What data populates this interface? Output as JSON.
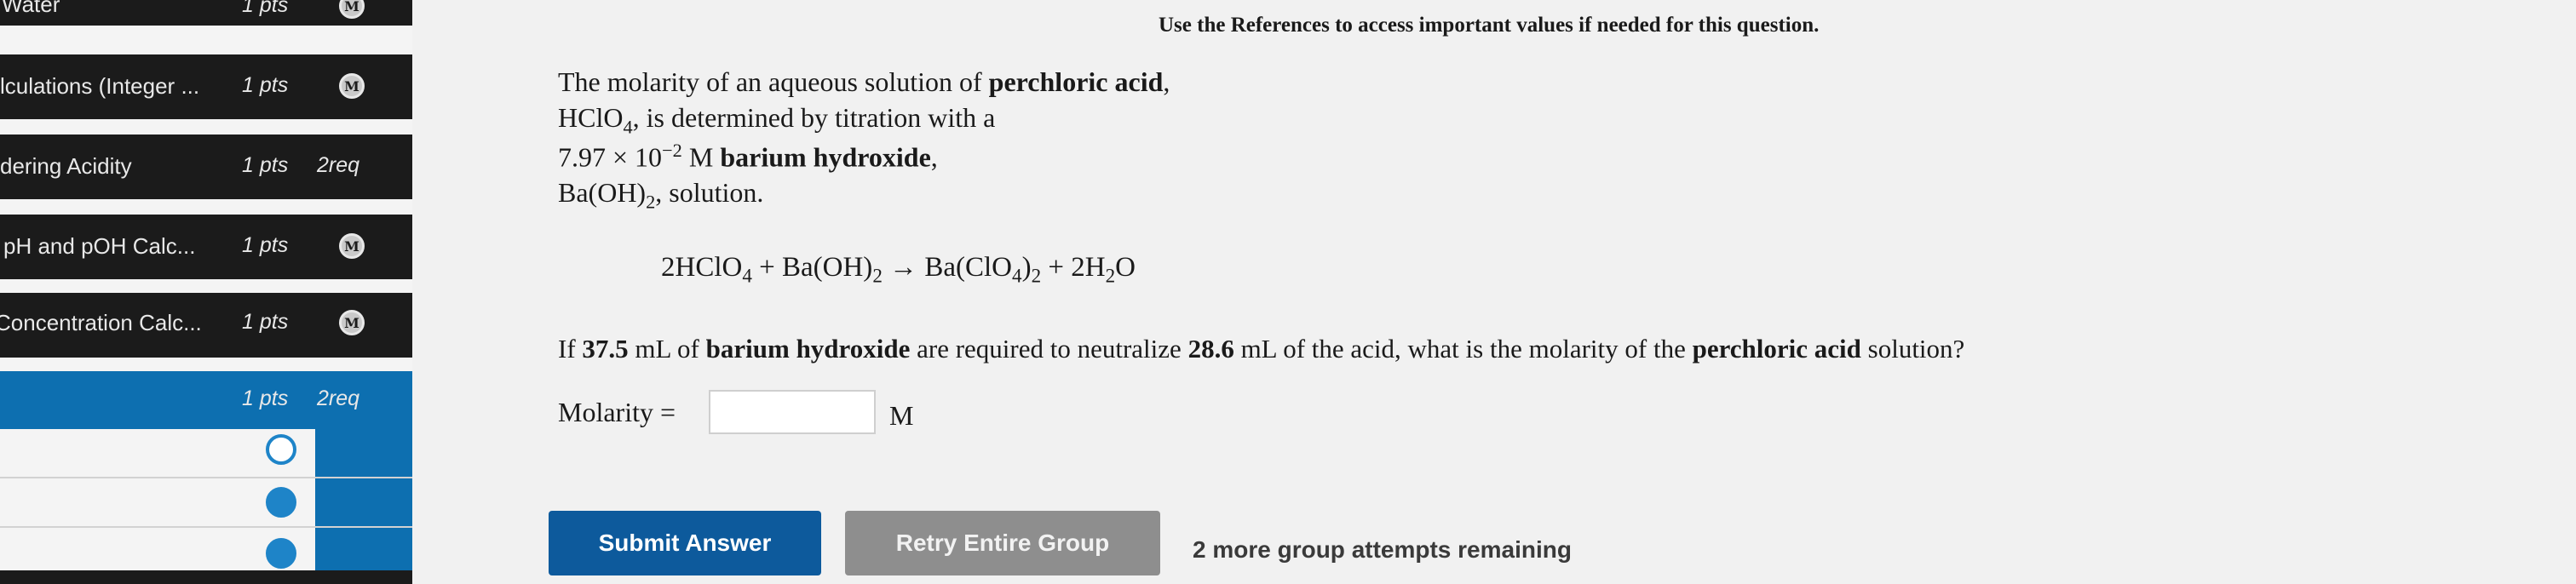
{
  "sidebar": {
    "rows": [
      {
        "name": "Water",
        "pts": "1 pts",
        "badge": "M"
      },
      {
        "name": "lculations (Integer ...",
        "pts": "1 pts",
        "badge": "M"
      },
      {
        "name": "dering Acidity",
        "pts": "1 pts",
        "req": "2req"
      },
      {
        "name": "pH and pOH Calc...",
        "pts": "1 pts",
        "badge": "M"
      },
      {
        "name": "Concentration Calc...",
        "pts": "1 pts",
        "badge": "M"
      },
      {
        "name": "",
        "pts": "1 pts",
        "req": "2req"
      }
    ],
    "question_dots": [
      "empty",
      "filled",
      "filled"
    ]
  },
  "references_note": "Use the References to access important values if needed for this question.",
  "problem": {
    "l1_a": "The molarity of an aqueous solution of ",
    "l1_b": "perchloric acid",
    "l1_c": ",",
    "l2_formula": "HClO",
    "l2_sub": "4",
    "l2_rest": ", is determined by titration with a",
    "l3_num": "7.97 × 10",
    "l3_exp": "−2",
    "l3_unit": " M ",
    "l3_bold": "barium hydroxide",
    "l3_comma": ",",
    "l4_formula": "Ba(OH)",
    "l4_sub": "2",
    "l4_rest": ", solution."
  },
  "equation": {
    "t1": "2HClO",
    "s1": "4",
    "t2": " + Ba(OH)",
    "s2": "2",
    "t3": " → Ba(ClO",
    "s3": "4",
    "t4": ")",
    "s4": "2",
    "t5": " + 2H",
    "s5": "2",
    "t6": "O"
  },
  "question": {
    "q1": "If ",
    "q2": "37.5",
    "q3": " mL of ",
    "q4": "barium hydroxide",
    "q5": " are required to neutralize ",
    "q6": "28.6",
    "q7": " mL of the acid, what is the molarity of the ",
    "q8": "perchloric acid",
    "q9": " solution?"
  },
  "answer": {
    "label": "Molarity =",
    "value": "",
    "unit": "M"
  },
  "buttons": {
    "submit": "Submit Answer",
    "retry": "Retry Entire Group"
  },
  "remaining": "2 more group attempts remaining",
  "colors": {
    "sidebar_dark": "#1b1b1b",
    "active_blue": "#0d6fb0",
    "submit_blue": "#0d5a9c",
    "retry_gray": "#8e8e8e"
  }
}
